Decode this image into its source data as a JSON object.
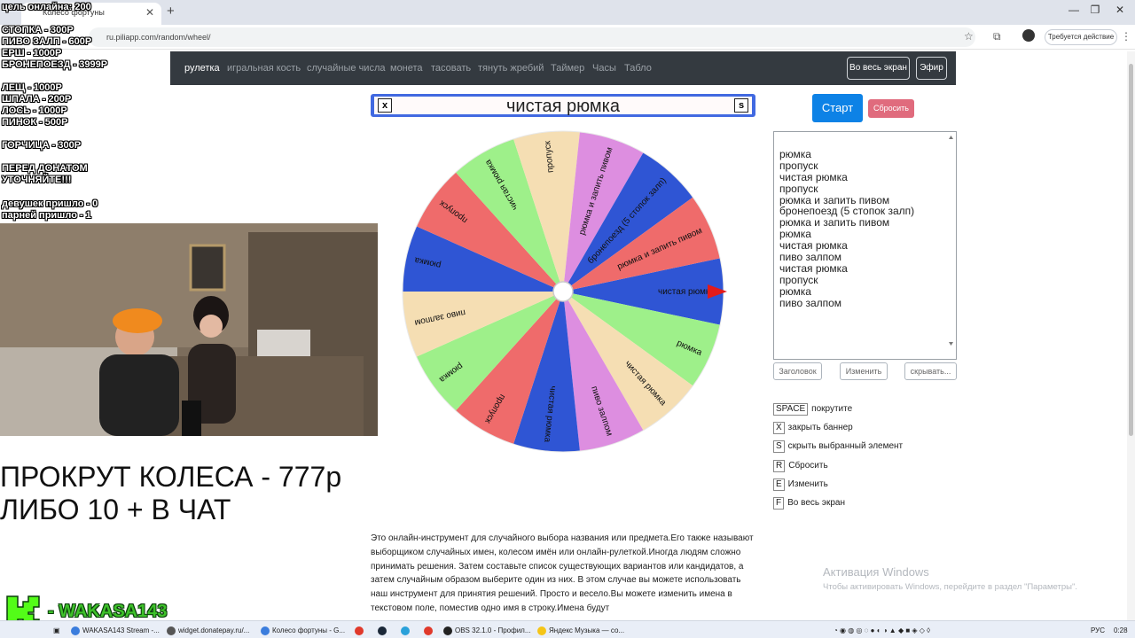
{
  "browser": {
    "tab_title": "Колесо фортуны",
    "url": "ru.piliapp.com/random/wheel/",
    "profile_label": "Требуется действие"
  },
  "nav": {
    "items": [
      "рулетка",
      "игральная кость",
      "случайные числа",
      "монета",
      "тасовать",
      "тянуть жребий",
      "Таймер",
      "Часы",
      "Табло"
    ],
    "fullscreen_label": "Во весь экран",
    "broadcast_label": "Эфир"
  },
  "banner": {
    "text": "чистая рюмка",
    "close_key": "x",
    "hide_key": "s"
  },
  "wheel": {
    "segments": [
      {
        "label": "чистая рюмка",
        "color": "#2f55d4"
      },
      {
        "label": "рюмка",
        "color": "#9ef08a"
      },
      {
        "label": "чистая рюмка",
        "color": "#f5deb3"
      },
      {
        "label": "пиво залпом",
        "color": "#dd8ee0"
      },
      {
        "label": "чистая рюмка",
        "color": "#2f55d4"
      },
      {
        "label": "пропуск",
        "color": "#ef6b6b"
      },
      {
        "label": "рюмка",
        "color": "#9ef08a"
      },
      {
        "label": "пиво залпом",
        "color": "#f5deb3"
      },
      {
        "label": "рюмка",
        "color": "#2f55d4"
      },
      {
        "label": "пропуск",
        "color": "#ef6b6b"
      },
      {
        "label": "чистая рюмка",
        "color": "#9ef08a"
      },
      {
        "label": "пропуск",
        "color": "#f5deb3"
      },
      {
        "label": "рюмка и запить пивом",
        "color": "#dd8ee0"
      },
      {
        "label": "бронепоезд (5 стопок залп)",
        "color": "#2f55d4"
      },
      {
        "label": "рюмка и запить пивом",
        "color": "#ef6b6b"
      }
    ],
    "pointer_color": "#e21b1b"
  },
  "controls": {
    "start_label": "Старт",
    "reset_label": "Сбросить",
    "names": [
      "рюмка",
      "пропуск",
      "чистая рюмка",
      "пропуск",
      "рюмка и запить пивом",
      "бронепоезд (5 стопок залп)",
      "рюмка и запить пивом",
      "рюмка",
      "чистая рюмка",
      "пиво залпом",
      "чистая рюмка",
      "пропуск",
      "рюмка",
      "пиво залпом"
    ],
    "title_button": "Заголовок",
    "edit_button": "Изменить",
    "hide_button": "скрывать..."
  },
  "shortcuts": [
    {
      "key": "SPACE",
      "text": "покрутите"
    },
    {
      "key": "X",
      "text": "закрыть баннер"
    },
    {
      "key": "S",
      "text": "скрыть выбранный элемент"
    },
    {
      "key": "R",
      "text": "Сбросить"
    },
    {
      "key": "E",
      "text": "Изменить"
    },
    {
      "key": "F",
      "text": "Во весь экран"
    }
  ],
  "description": "Это онлайн-инструмент для случайного выбора названия или предмета.Его также называют выборщиком случайных имен, колесом имён или онлайн-рулеткой.Иногда людям сложно принимать решения. Затем составьте список существующих вариантов или кандидатов, а затем случайным образом выберите один из них. В этом случае вы можете использовать наш инструмент для принятия решений. Просто и весело.Вы можете изменить имена в текстовом поле, поместив одно имя в строку.Имена будут",
  "windows_watermark": {
    "title": "Активация Windows",
    "subtitle": "Чтобы активировать Windows, перейдите в раздел \"Параметры\"."
  },
  "overlay": {
    "lines": [
      "цель онлайна: 200",
      "СТОПКА - 300Р",
      "ПИВО ЗАЛП - 600Р",
      "ЕРШ - 1000Р",
      "БРОНЕПОЕЗД - 3999Р",
      "ЛЕЩ - 1000Р",
      "ШПАЛА - 200Р",
      "ЛОСЬ - 1000Р",
      "ПИНОК - 500Р",
      "ГОРЧИЦА - 300Р",
      "ПЕРЕД  ДОНАТОМ",
      "УТОЧНЯЙТЕ!!!",
      "девушек пришло - 0",
      "парней пришло - 1"
    ],
    "promo_line1": "ПРОКРУТ КОЛЕСА - 777р",
    "promo_line2": "ЛИБО 10 + В ЧАТ",
    "brand": "- WAKASA143"
  },
  "taskbar": {
    "items": [
      "WAKASA143 Stream -...",
      "widget.donatepay.ru/...",
      "Колесо фортуны - G...",
      "OBS 32.1.0 - Профил...",
      "Яндекс Музыка — со..."
    ],
    "lang": "РУС",
    "time": "0:28"
  }
}
